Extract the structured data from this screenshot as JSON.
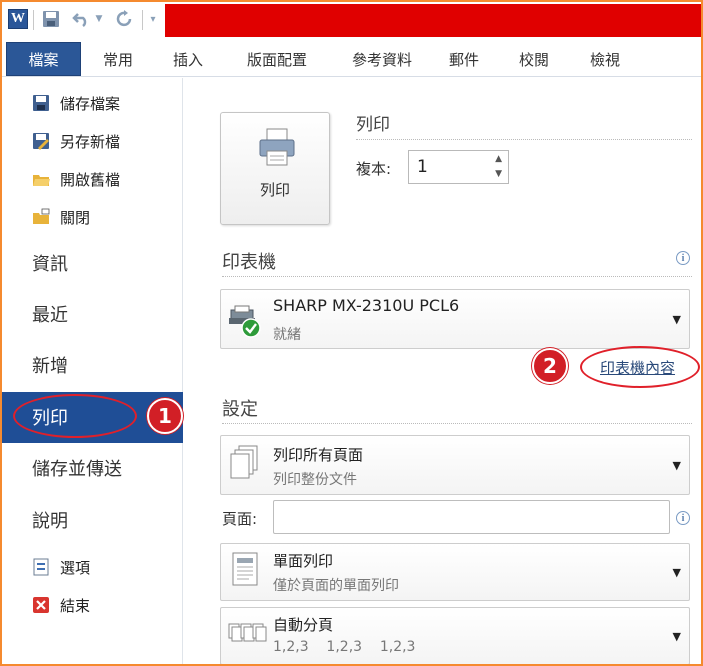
{
  "qat": {
    "word_logo": "W",
    "icons": [
      "save-icon",
      "undo-icon",
      "redo-icon",
      "customize-icon"
    ]
  },
  "ribbon": {
    "file_tab": "檔案",
    "tabs": [
      "常用",
      "插入",
      "版面配置",
      "參考資料",
      "郵件",
      "校閱",
      "檢視"
    ]
  },
  "backstage": {
    "commands": [
      {
        "label": "儲存檔案",
        "icon": "save-icon"
      },
      {
        "label": "另存新檔",
        "icon": "save-as-icon"
      },
      {
        "label": "開啟舊檔",
        "icon": "open-folder-icon"
      },
      {
        "label": "關閉",
        "icon": "close-folder-icon"
      }
    ],
    "nav": {
      "info": "資訊",
      "recent": "最近",
      "new": "新增",
      "print": "列印",
      "save_send": "儲存並傳送",
      "help": "說明"
    },
    "bottom": [
      {
        "label": "選項",
        "icon": "options-icon"
      },
      {
        "label": "結束",
        "icon": "exit-icon"
      }
    ]
  },
  "print_panel": {
    "print_button_label": "列印",
    "title": "列印",
    "copies_label": "複本:",
    "copies_value": "1",
    "printer_section": "印表機",
    "printer_name": "SHARP MX-2310U PCL6",
    "printer_status": "就緒",
    "printer_properties_link": "印表機內容",
    "settings_section": "設定",
    "pages_label": "頁面:",
    "pages_value": "",
    "settings": [
      {
        "title": "列印所有頁面",
        "subtitle": "列印整份文件",
        "icon": "all-pages-icon"
      },
      {
        "title": "單面列印",
        "subtitle": "僅於頁面的單面列印",
        "icon": "one-sided-icon"
      },
      {
        "title": "自動分頁",
        "subtitle": "1,2,3    1,2,3    1,2,3",
        "icon": "collated-icon"
      }
    ]
  },
  "annotations": {
    "badge_1": "1",
    "badge_2": "2",
    "color": "#d21f26"
  },
  "colors": {
    "file_tab": "#2b5797",
    "selected_nav": "#1f4e96",
    "title_bar": "#e00000",
    "frame": "#f58a2f"
  }
}
